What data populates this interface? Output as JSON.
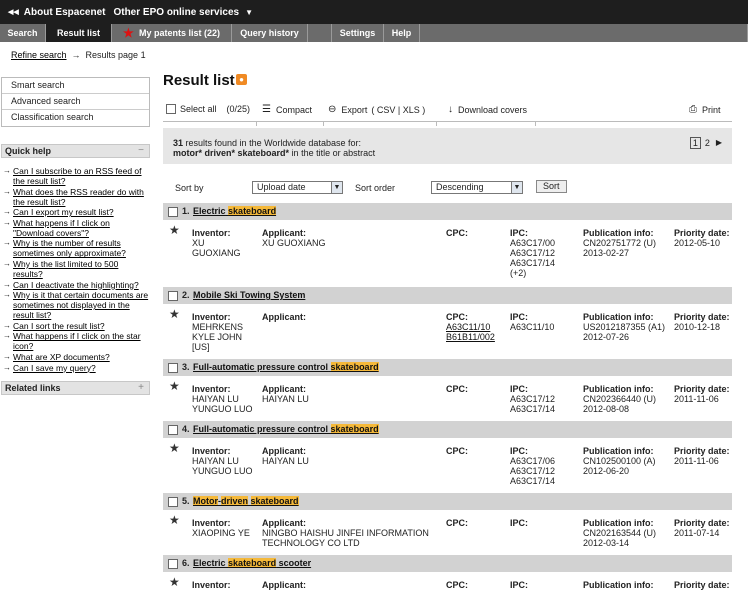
{
  "topbar": {
    "about": "About Espacenet",
    "other": "Other EPO online services"
  },
  "tabs": {
    "search": "Search",
    "result_list": "Result list",
    "my_patents": "My patents list (22)",
    "query_history": "Query history",
    "settings": "Settings",
    "help": "Help"
  },
  "breadcrumb": {
    "refine": "Refine search",
    "page": "Results page 1"
  },
  "search_links": [
    "Smart search",
    "Advanced search",
    "Classification search"
  ],
  "quick_help": {
    "title": "Quick help",
    "toggle": "−",
    "items": [
      "Can I subscribe to an RSS feed of the result list?",
      "What does the RSS reader do with the result list?",
      "Can I export my result list?",
      "What happens if I click on \"Download covers\"?",
      "Why is the number of results sometimes only approximate?",
      "Why is the list limited to 500 results?",
      "Can I deactivate the highlighting?",
      "Why is it that certain documents are sometimes not displayed in the result list?",
      "Can I sort the result list?",
      "What happens if I click on the star icon?",
      "What are XP documents?",
      "Can I save my query?"
    ]
  },
  "related_links": {
    "title": "Related links",
    "toggle": "+"
  },
  "main": {
    "title": "Result list",
    "select_all": "Select all",
    "count": "(0/25)",
    "compact": "Compact",
    "export": "Export",
    "export_formats": "( CSV | XLS )",
    "download_covers": "Download covers",
    "print": "Print",
    "summary_count": "31",
    "summary_text": "results found in the Worldwide database for:",
    "query": "motor* driven* skateboard*",
    "query_suffix": "in the title or abstract",
    "page_current": "1",
    "page_next": "2",
    "sort_by_label": "Sort by",
    "sort_by_value": "Upload date",
    "sort_order_label": "Sort order",
    "sort_order_value": "Descending",
    "sort_button": "Sort"
  },
  "labels": {
    "inventor": "Inventor:",
    "applicant": "Applicant:",
    "cpc": "CPC:",
    "ipc": "IPC:",
    "pubinfo": "Publication info:",
    "priority": "Priority date:"
  },
  "results": [
    {
      "num": "1.",
      "title_parts": [
        "Electric",
        " ",
        "skateboard"
      ],
      "highlight": [
        false,
        false,
        true
      ],
      "inventor": [
        "XU",
        "GUOXIANG"
      ],
      "applicant": [
        "XU GUOXIANG"
      ],
      "cpc": [],
      "ipc": [
        "A63C17/00",
        "A63C17/12",
        "A63C17/14",
        "(+2)"
      ],
      "pub": [
        "CN202751772 (U)",
        "2013-02-27"
      ],
      "priority": "2012-05-10"
    },
    {
      "num": "2.",
      "title_parts": [
        "Mobile Ski Towing System"
      ],
      "highlight": [
        false
      ],
      "inventor": [
        "MEHRKENS",
        "KYLE JOHN",
        "[US]"
      ],
      "applicant": [],
      "cpc": [
        "A63C11/10",
        "B61B11/002"
      ],
      "ipc": [
        "A63C11/10"
      ],
      "pub": [
        "US2012187355 (A1)",
        "2012-07-26"
      ],
      "priority": "2010-12-18"
    },
    {
      "num": "3.",
      "title_parts": [
        "Full-automatic pressure control",
        " ",
        "skateboard"
      ],
      "highlight": [
        false,
        false,
        true
      ],
      "inventor": [
        "HAIYAN LU",
        "YUNGUO LUO"
      ],
      "applicant": [
        "HAIYAN LU"
      ],
      "cpc": [],
      "ipc": [
        "A63C17/12",
        "A63C17/14"
      ],
      "pub": [
        "CN202366440 (U)",
        "2012-08-08"
      ],
      "priority": "2011-11-06"
    },
    {
      "num": "4.",
      "title_parts": [
        "Full-automatic pressure control",
        " ",
        "skateboard"
      ],
      "highlight": [
        false,
        false,
        true
      ],
      "inventor": [
        "HAIYAN LU",
        "YUNGUO LUO"
      ],
      "applicant": [
        "HAIYAN LU"
      ],
      "cpc": [],
      "ipc": [
        "A63C17/06",
        "A63C17/12",
        "A63C17/14"
      ],
      "pub": [
        "CN102500100 (A)",
        "2012-06-20"
      ],
      "priority": "2011-11-06"
    },
    {
      "num": "5.",
      "title_parts": [
        "Motor",
        "-",
        "driven",
        " ",
        "skateboard"
      ],
      "highlight": [
        true,
        false,
        true,
        false,
        true
      ],
      "inventor": [
        "XIAOPING YE"
      ],
      "applicant": [
        "NINGBO HAISHU JINFEI INFORMATION",
        "TECHNOLOGY CO LTD"
      ],
      "cpc": [],
      "ipc": [],
      "pub": [
        "CN202163544 (U)",
        "2012-03-14"
      ],
      "priority": "2011-07-14"
    },
    {
      "num": "6.",
      "title_parts": [
        "Electric",
        " ",
        "skateboard",
        " scooter"
      ],
      "highlight": [
        false,
        false,
        true,
        false
      ],
      "inventor": [],
      "applicant": [],
      "cpc": [],
      "ipc": [],
      "pub": [],
      "priority": ""
    }
  ]
}
